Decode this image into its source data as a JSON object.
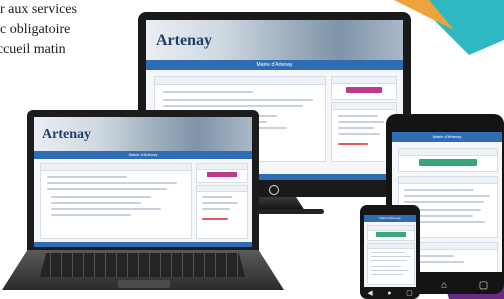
{
  "intro_text": {
    "line1": "r aux services",
    "line2": "onc obligatoire",
    "line3": "(accueil matin"
  },
  "brand": "Artenay",
  "site_title": "Mairie d'Artenay",
  "colors": {
    "accent_blue": "#2e6db4",
    "teal": "#2fb8c4",
    "purple": "#6b2a82",
    "button_magenta": "#c0398a",
    "tablet_green": "#38a87a"
  },
  "icons": {
    "power": "power-icon",
    "tablet_back": "back-icon",
    "tablet_home": "home-icon",
    "tablet_recent": "recent-apps-icon"
  }
}
